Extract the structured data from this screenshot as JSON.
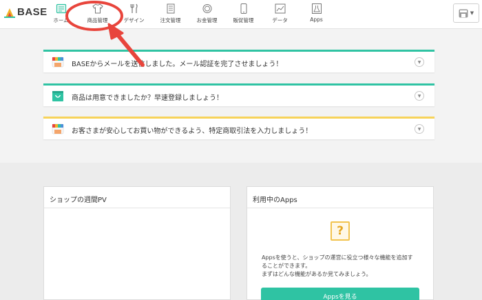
{
  "header": {
    "logo_text": "BASE",
    "nav": [
      {
        "label": "ホーム",
        "icon": "home-icon"
      },
      {
        "label": "商品管理",
        "icon": "tshirt-icon"
      },
      {
        "label": "デザイン",
        "icon": "utensils-icon"
      },
      {
        "label": "注文管理",
        "icon": "document-icon"
      },
      {
        "label": "お金管理",
        "icon": "coin-icon"
      },
      {
        "label": "販促管理",
        "icon": "phone-icon"
      },
      {
        "label": "データ",
        "icon": "chart-icon"
      },
      {
        "label": "Apps",
        "icon": "flask-icon"
      }
    ],
    "store_icon": "store-icon"
  },
  "alerts": [
    {
      "text": "BASEからメールを送信しました。メール認証を完了させましょう！",
      "color": "#2fc3a3",
      "icon": "store-icon"
    },
    {
      "text": "商品は用意できましたか？早速登録しましょう！",
      "color": "#2fc3a3",
      "icon": "shopping-bag-icon"
    },
    {
      "text": "お客さまが安心してお買い物ができるよう、特定商取引法を入力しましょう！",
      "color": "#f7d35a",
      "icon": "store-icon"
    }
  ],
  "panels": {
    "pv_title": "ショップの週間PV",
    "apps_title": "利用中のApps",
    "apps_desc_line1": "Appsを使うと、ショップの運営に役立つ様々な機能を追加す",
    "apps_desc_line2": "ることができます。",
    "apps_desc_line3": "まずはどんな機能があるか見てみましょう。",
    "apps_button": "Appsを見る",
    "apps_placeholder_glyph": "?"
  },
  "colors": {
    "accent": "#2fc3a3",
    "warning": "#f7d35a",
    "annotation": "#e8453c"
  }
}
